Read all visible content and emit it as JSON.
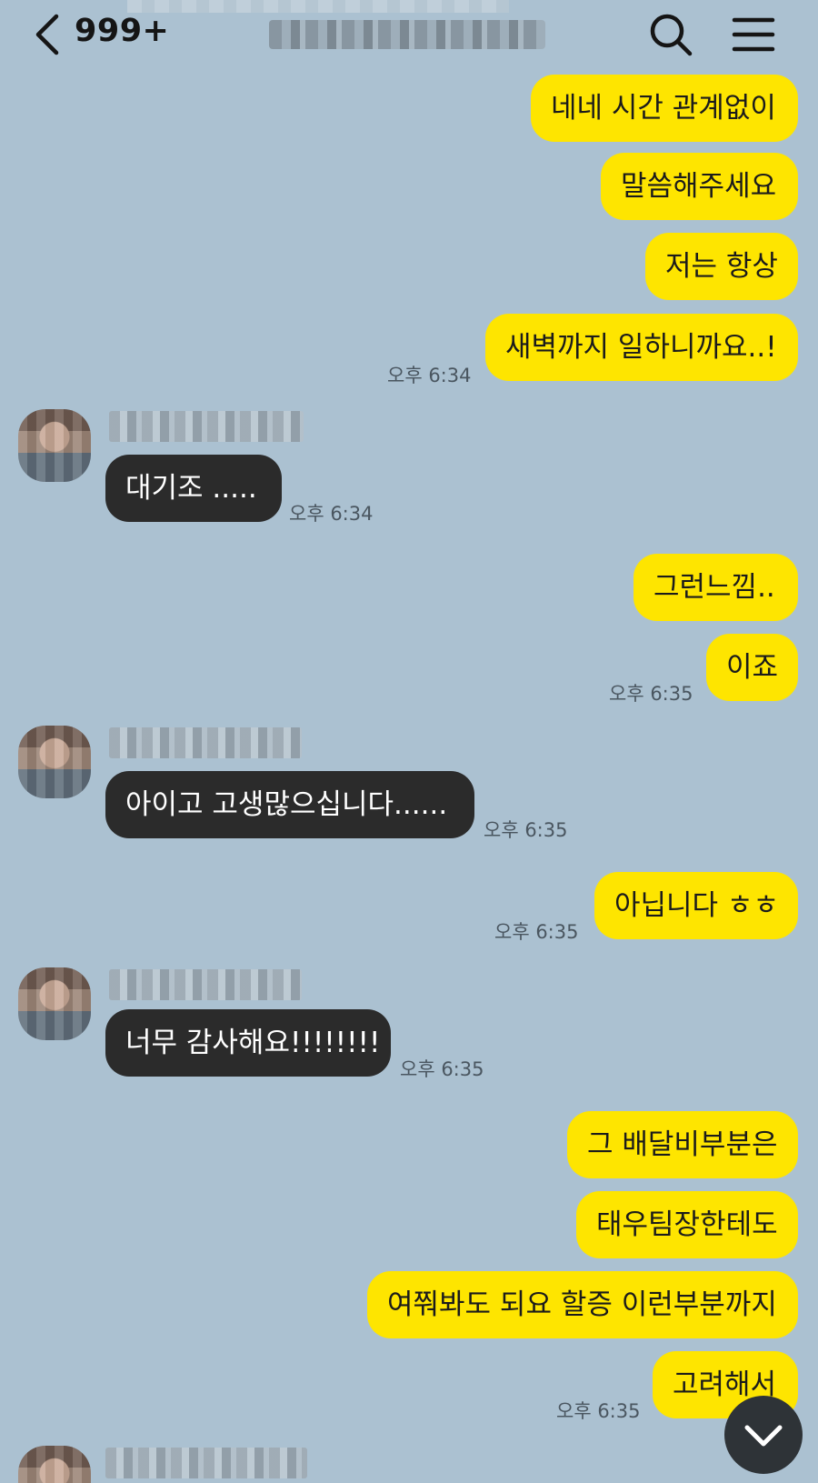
{
  "header": {
    "back_count": "999+"
  },
  "messages": [
    {
      "side": "mine",
      "text": "네네 시간 관계없이"
    },
    {
      "side": "mine",
      "text": "말씀해주세요"
    },
    {
      "side": "mine",
      "text": "저는 항상"
    },
    {
      "side": "mine",
      "text": "새벽까지 일하니까요..!",
      "time": "오후 6:34"
    },
    {
      "side": "theirs",
      "text": "대기조 .....",
      "time": "오후 6:34"
    },
    {
      "side": "mine",
      "text": "그런느낌.."
    },
    {
      "side": "mine",
      "text": "이죠",
      "time": "오후 6:35"
    },
    {
      "side": "theirs",
      "text": "아이고 고생많으십니다......",
      "time": "오후 6:35"
    },
    {
      "side": "mine",
      "text": "아닙니다 ㅎㅎ",
      "time": "오후 6:35"
    },
    {
      "side": "theirs",
      "text": "너무 감사해요!!!!!!!!",
      "time": "오후 6:35"
    },
    {
      "side": "mine",
      "text": "그 배달비부분은"
    },
    {
      "side": "mine",
      "text": "태우팀장한테도"
    },
    {
      "side": "mine",
      "text": "여쭤봐도 되요 할증 이런부분까지"
    },
    {
      "side": "mine",
      "text": "고려해서",
      "time": "오후 6:35"
    }
  ],
  "colors": {
    "background": "#abc1d1",
    "my_bubble": "#fee500",
    "their_bubble": "#2b2b2b"
  },
  "icons": [
    "back-chevron-icon",
    "search-icon",
    "menu-icon",
    "chevron-down-icon"
  ]
}
